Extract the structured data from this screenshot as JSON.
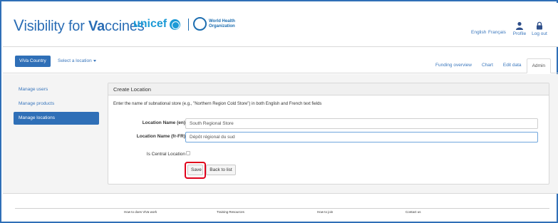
{
  "header": {
    "brand_v": "V",
    "brand_rest1": "isibility for ",
    "brand_va": "Va",
    "brand_rest2": "ccines",
    "unicef_label": "unicef",
    "who_label": "World Health Organization",
    "lang_en": "English",
    "lang_fr": "Français",
    "profile_label": "Profile",
    "logout_label": "Log out"
  },
  "nav": {
    "country_button": "ViVa Country",
    "location_select": "Select a location",
    "tabs": [
      {
        "label": "Funding overview"
      },
      {
        "label": "Chart"
      },
      {
        "label": "Edit data"
      },
      {
        "label": "Admin"
      }
    ]
  },
  "sidebar": {
    "items": [
      {
        "label": "Manage users"
      },
      {
        "label": "Manage products"
      },
      {
        "label": "Manage locations"
      }
    ]
  },
  "panel": {
    "title": "Create Location",
    "instructions": "Enter the name of subnational store (e.g., \"Northern Region Cold Store\") in both English and French text fields",
    "name_en_label": "Location Name (en)",
    "name_en_value": "South Regional Store",
    "name_fr_label": "Location Name (fr-FR)",
    "name_fr_value": "Dépôt régional du sud",
    "central_label": "Is Central Location",
    "central_checked": false,
    "save_button": "Save",
    "back_button": "Back to list"
  },
  "footer": {
    "links": [
      {
        "label": "How to does ViVa work"
      },
      {
        "label": "Training Resources"
      },
      {
        "label": "How to join"
      },
      {
        "label": "Contact us"
      }
    ]
  },
  "colors": {
    "brand_blue": "#2a6db5",
    "primary_button": "#2f6fb7",
    "unicef_blue": "#1c9ad6",
    "highlight_red": "#e0001b",
    "frame_blue": "#2f6fb7"
  }
}
